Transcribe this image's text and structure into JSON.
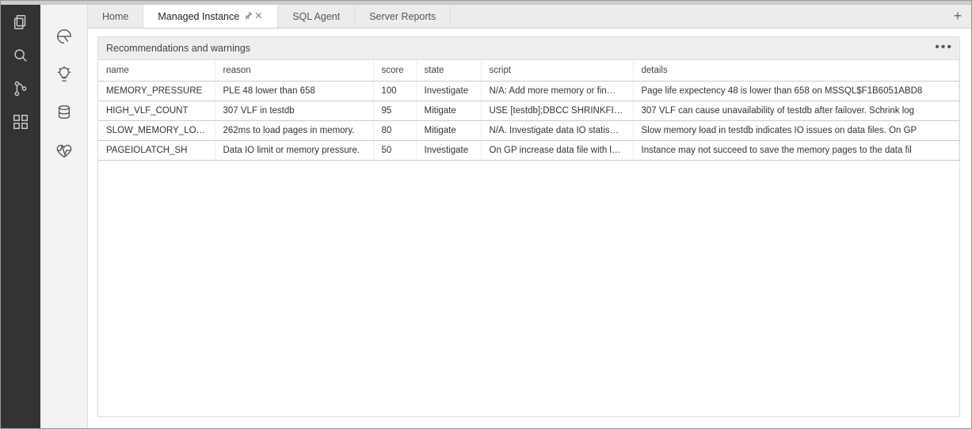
{
  "activityBar": {
    "items": [
      "files-icon",
      "search-icon",
      "source-control-icon",
      "extensions-icon"
    ]
  },
  "sidePanel": {
    "items": [
      "dashboard-icon",
      "insight-icon",
      "database-icon",
      "health-icon"
    ]
  },
  "tabs": {
    "items": [
      {
        "label": "Home",
        "active": false
      },
      {
        "label": "Managed Instance",
        "active": true
      },
      {
        "label": "SQL Agent",
        "active": false
      },
      {
        "label": "Server Reports",
        "active": false
      }
    ]
  },
  "panel": {
    "title": "Recommendations and warnings"
  },
  "table": {
    "headers": {
      "name": "name",
      "reason": "reason",
      "score": "score",
      "state": "state",
      "script": "script",
      "details": "details"
    },
    "rows": [
      {
        "name": "MEMORY_PRESSURE",
        "reason": "PLE 48 lower than 658",
        "score": "100",
        "state": "Investigate",
        "script": "N/A: Add more memory or fin…",
        "details": "Page life expectency 48 is lower than 658 on MSSQL$F1B6051ABD8"
      },
      {
        "name": "HIGH_VLF_COUNT",
        "reason": "307 VLF in testdb",
        "score": "95",
        "state": "Mitigate",
        "script": "USE [testdb];DBCC SHRINKFIL…",
        "details": "307 VLF can cause unavailability of testdb after failover. Schrink log"
      },
      {
        "name": "SLOW_MEMORY_LOAD",
        "reason": "262ms to load pages in memory.",
        "score": "80",
        "state": "Mitigate",
        "script": "N/A. Investigate data IO statis…",
        "details": "Slow memory load in testdb indicates IO issues on data files. On GP"
      },
      {
        "name": "PAGEIOLATCH_SH",
        "reason": "Data IO limit or memory pressure.",
        "score": "50",
        "state": "Investigate",
        "script": "On GP increase data file with l…",
        "details": "Instance may not succeed to save the memory pages to the data fil"
      }
    ]
  }
}
